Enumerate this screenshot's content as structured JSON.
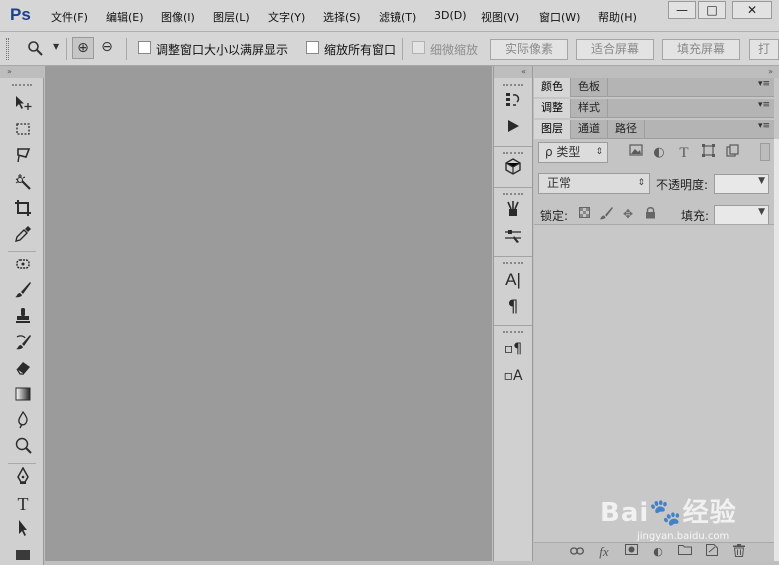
{
  "app": {
    "logo": "Ps"
  },
  "menu": [
    "文件(F)",
    "编辑(E)",
    "图像(I)",
    "图层(L)",
    "文字(Y)",
    "选择(S)",
    "滤镜(T)",
    "3D(D)",
    "视图(V)",
    "窗口(W)",
    "帮助(H)"
  ],
  "window_controls": {
    "minimize": "—",
    "restore": "□",
    "close": "✕"
  },
  "options": {
    "tool_preset_icon": "zoom-icon",
    "zoom_in": "⊕",
    "zoom_out": "⊖",
    "resize_windows_label": "调整窗口大小以满屏显示",
    "zoom_all_windows_label": "缩放所有窗口",
    "scrubby_zoom_label": "细微缩放",
    "actual_pixels": "实际像素",
    "fit_screen": "适合屏幕",
    "fill_screen": "填充屏幕",
    "print_size": "打"
  },
  "panel_headers": {
    "collapse_left": "»",
    "collapse_right": "«"
  },
  "panels": {
    "row1": [
      "颜色",
      "色板"
    ],
    "row2": [
      "调整",
      "样式"
    ],
    "row3": [
      "图层",
      "通道",
      "路径"
    ],
    "tab_menu": "▾≡"
  },
  "layers": {
    "filter_kind": "ρ 类型",
    "blend_mode": "正常",
    "opacity_label": "不透明度:",
    "lock_label": "锁定:",
    "fill_label": "填充:"
  },
  "watermark": {
    "brand": "Bai🐾经验",
    "url": "jingyan.baidu.com"
  }
}
